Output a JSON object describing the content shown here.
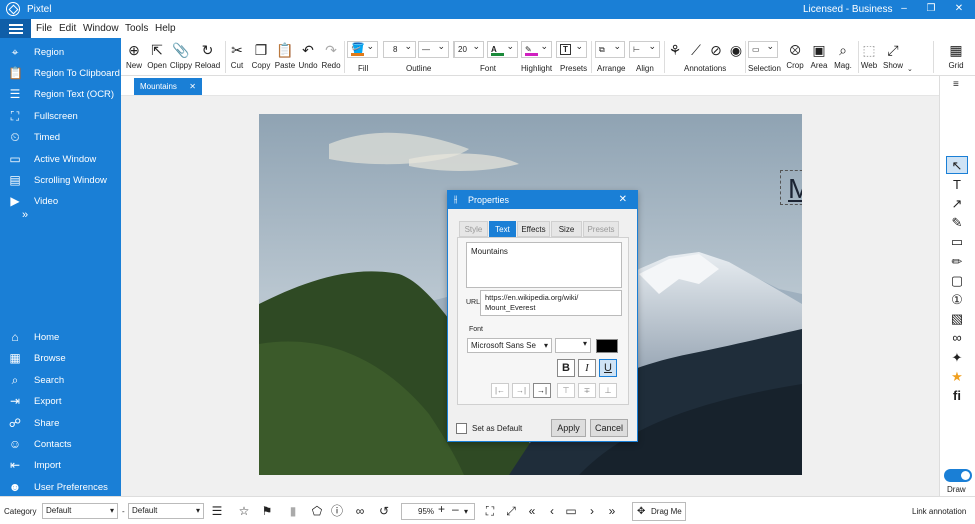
{
  "app": {
    "name": "Pixtel",
    "license": "Licensed - Business"
  },
  "window_controls": {
    "minimize": "–",
    "restore": "❐",
    "close": "✕"
  },
  "menu": [
    "File",
    "Edit",
    "Window",
    "Tools",
    "Help"
  ],
  "sidebar": {
    "capture": [
      {
        "label": "Region",
        "icon": "region-icon"
      },
      {
        "label": "Region To Clipboard",
        "icon": "clipboard-icon"
      },
      {
        "label": "Region Text (OCR)",
        "icon": "ocr-icon"
      },
      {
        "label": "Fullscreen",
        "icon": "fullscreen-icon"
      },
      {
        "label": "Timed",
        "icon": "timer-icon"
      },
      {
        "label": "Active Window",
        "icon": "window-icon"
      },
      {
        "label": "Scrolling Window",
        "icon": "scroll-icon"
      },
      {
        "label": "Video",
        "icon": "video-icon"
      }
    ],
    "more": "»",
    "nav": [
      {
        "label": "Home",
        "icon": "home-icon"
      },
      {
        "label": "Browse",
        "icon": "browse-icon"
      },
      {
        "label": "Search",
        "icon": "search-icon"
      },
      {
        "label": "Export",
        "icon": "export-icon"
      },
      {
        "label": "Share",
        "icon": "share-icon"
      },
      {
        "label": "Contacts",
        "icon": "contacts-icon"
      },
      {
        "label": "Import",
        "icon": "import-icon"
      },
      {
        "label": "User Preferences",
        "icon": "user-icon"
      }
    ]
  },
  "toolbar": {
    "new": "New",
    "open": "Open",
    "clippy": "Clippy",
    "reload": "Reload",
    "cut": "Cut",
    "copy": "Copy",
    "paste": "Paste",
    "undo": "Undo",
    "redo": "Redo",
    "fill": "Fill",
    "outline": "Outline",
    "outline_width": "8",
    "font": "Font",
    "font_size": "20",
    "highlight": "Highlight",
    "presets": "Presets",
    "arrange": "Arrange",
    "align": "Align",
    "annotations": "Annotations",
    "selection": "Selection",
    "crop": "Crop",
    "area": "Area",
    "mag": "Mag.",
    "web": "Web",
    "show": "Show",
    "grid": "Grid",
    "fill_color": "#e07b1a",
    "font_color": "#1a8a3a",
    "highlight_color": "#d020c0"
  },
  "document_tab": {
    "label": "Mountains",
    "close": "✕"
  },
  "canvas": {
    "title_text": "Mountains"
  },
  "dialog": {
    "title": "Properties",
    "close": "✕",
    "tabs": [
      "Style",
      "Text",
      "Effects",
      "Size",
      "Presets"
    ],
    "active_tab": "Text",
    "text_value": "Mountains",
    "url_label": "URL",
    "url_line1": "https://en.wikipedia.org/wiki/",
    "url_line2": "Mount_Everest",
    "font_label": "Font",
    "font_value": "Microsoft Sans Se",
    "bold": "B",
    "italic": "I",
    "underline": "U",
    "set_default_label": "Set as Default",
    "apply": "Apply",
    "cancel": "Cancel"
  },
  "right_tools": {
    "draw_label": "Draw",
    "draw_enabled": true
  },
  "bottom": {
    "category_label": "Category",
    "category_value": "Default",
    "dash": "-",
    "second_value": "Default",
    "zoom": "95%",
    "drag_me": "Drag Me",
    "link_annotation": "Link annotation"
  },
  "colors": {
    "accent": "#1a7fd6"
  }
}
